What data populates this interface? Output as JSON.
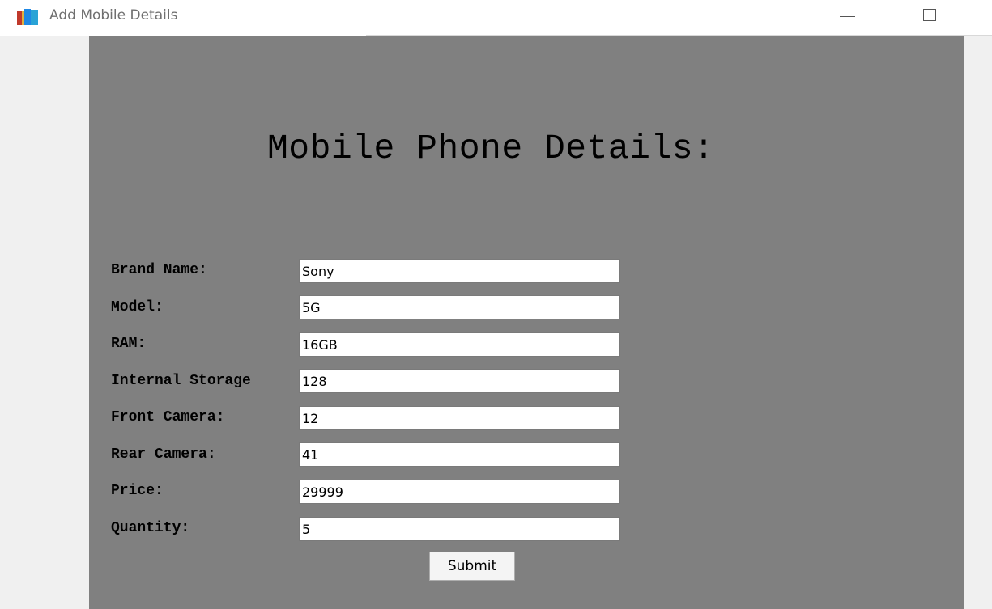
{
  "window": {
    "title": "Add Mobile Details",
    "icon": "books-app-icon"
  },
  "heading": "Mobile Phone Details:",
  "form": {
    "fields": [
      {
        "label": "Brand Name:",
        "value": "Sony"
      },
      {
        "label": "Model:",
        "value": "5G"
      },
      {
        "label": "RAM:",
        "value": "16GB"
      },
      {
        "label": "Internal Storage",
        "value": "128"
      },
      {
        "label": "Front Camera:",
        "value": "12"
      },
      {
        "label": "Rear Camera:",
        "value": "41"
      },
      {
        "label": "Price:",
        "value": "29999"
      },
      {
        "label": "Quantity:",
        "value": "5"
      }
    ],
    "submit_label": "Submit"
  },
  "colors": {
    "panel_background": "#808080",
    "window_background": "#f0f0f0",
    "titlebar_background": "#ffffff"
  }
}
